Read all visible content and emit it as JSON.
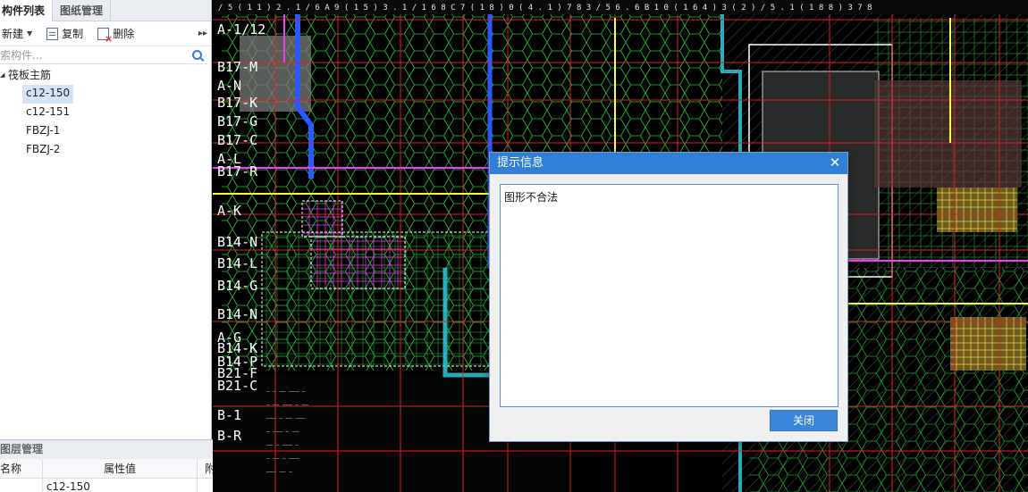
{
  "left_panel": {
    "tabs": [
      {
        "label": "构件列表",
        "active": true
      },
      {
        "label": "图纸管理",
        "active": false
      }
    ],
    "toolbar": {
      "new_label": "新建",
      "copy_label": "复制",
      "delete_label": "删除"
    },
    "search": {
      "placeholder": "索构件..."
    },
    "tree": {
      "root_label": "筏板主筋",
      "items": [
        {
          "label": "c12-150",
          "selected": true
        },
        {
          "label": "c12-151",
          "selected": false
        },
        {
          "label": "FBZJ-1",
          "selected": false
        },
        {
          "label": "FBZJ-2",
          "selected": false
        }
      ]
    }
  },
  "layer_panel": {
    "title": "图层管理",
    "columns": [
      "名称",
      "属性值",
      "附加"
    ],
    "rows": [
      {
        "name": "",
        "value": "c12-150",
        "extra": ""
      }
    ]
  },
  "canvas": {
    "axis_labels": [
      "A-1/12",
      "B17-M",
      "A-N",
      "B17-K",
      "B17-G",
      "B17-C",
      "A-L",
      "B17-R",
      "A-K",
      "B14-N",
      "B14-L",
      "B14-G",
      "B14-N",
      "A-G",
      "B14-K",
      "B14-P",
      "B21-F",
      "B21-C",
      "B-1",
      "B-R"
    ],
    "colors": {
      "grid_green": "#22c43a",
      "axis_red": "#e02020",
      "magenta": "#ff33ff",
      "yellow": "#ffff33",
      "cyan": "#33c7d6",
      "blue": "#2a5aff",
      "grey_hatch": "#8a8a8a"
    }
  },
  "dialog": {
    "title": "提示信息",
    "message": "图形不合法",
    "close_button_label": "关闭",
    "title_bar_color": "#2f7fd6"
  }
}
